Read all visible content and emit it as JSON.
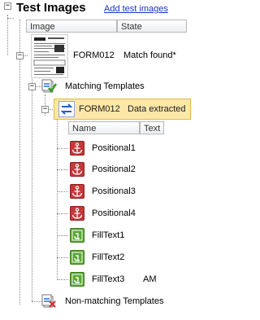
{
  "header": {
    "title": "Test Images",
    "add_link": "Add test images",
    "collapse_glyph": "−"
  },
  "images_table": {
    "columns": [
      "Image",
      "State"
    ]
  },
  "form_node": {
    "name": "FORM012",
    "state": "Match found*",
    "collapse_glyph": "−"
  },
  "matching": {
    "label": "Matching Templates",
    "collapse_glyph": "−"
  },
  "template": {
    "name": "FORM012",
    "state": "Data extracted",
    "collapse_glyph": "−",
    "highlight_color": "#fce7a8"
  },
  "fields_table": {
    "columns": [
      "Name",
      "Text"
    ],
    "rows": [
      {
        "icon": "anchor-icon",
        "name": "Positional1",
        "text": ""
      },
      {
        "icon": "anchor-icon",
        "name": "Positional2",
        "text": ""
      },
      {
        "icon": "anchor-icon",
        "name": "Positional3",
        "text": ""
      },
      {
        "icon": "anchor-icon",
        "name": "Positional4",
        "text": ""
      },
      {
        "icon": "text-field-icon",
        "name": "FillText1",
        "text": ""
      },
      {
        "icon": "text-field-icon",
        "name": "FillText2",
        "text": ""
      },
      {
        "icon": "text-field-icon",
        "name": "FillText3",
        "text": "AM"
      }
    ]
  },
  "non_matching": {
    "label": "Non-matching Templates"
  },
  "colors": {
    "link": "#1a33cc",
    "anchor": "#c23a3a",
    "text_field": "#5aa832"
  }
}
